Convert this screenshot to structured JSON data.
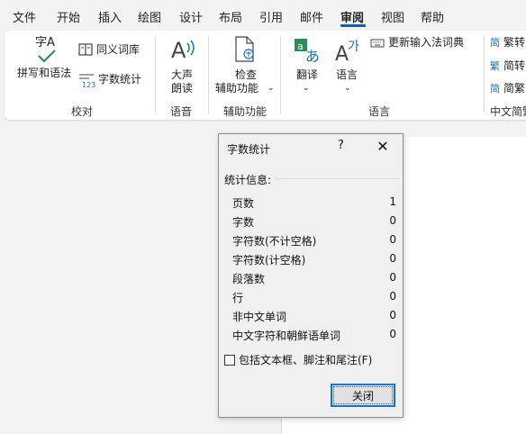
{
  "menu": {
    "items": [
      "文件",
      "开始",
      "插入",
      "绘图",
      "设计",
      "布局",
      "引用",
      "邮件",
      "审阅",
      "视图",
      "帮助"
    ],
    "active": "审阅"
  },
  "ribbon": {
    "proofing": {
      "spelling_label": "拼写和语法",
      "spelling_icon_text": "字A",
      "thesaurus_label": "同义词库",
      "wordcount_label": "字数统计",
      "wordcount_icon_text": "123",
      "group_label": "校对"
    },
    "speech": {
      "read_aloud_line1": "大声",
      "read_aloud_line2": "朗读",
      "group_label": "语音"
    },
    "accessibility": {
      "check_line1": "检查",
      "check_line2": "辅助功能",
      "group_label": "辅助功能"
    },
    "language": {
      "translate_label": "翻译",
      "language_label": "语言",
      "ime_label": "更新输入法词典",
      "group_label": "语言"
    },
    "chinese": {
      "to_trad": "繁转",
      "to_simp": "简转",
      "simp_trad": "简繁",
      "trad_glyph": "简",
      "simp_glyph": "繁",
      "conv_glyph": "简",
      "group_label": "中文简繁"
    }
  },
  "dialog": {
    "title": "字数统计",
    "help": "?",
    "close_glyph": "✕",
    "section_label": "统计信息:",
    "stats": [
      {
        "label": "页数",
        "value": "1"
      },
      {
        "label": "字数",
        "value": "0"
      },
      {
        "label": "字符数(不计空格)",
        "value": "0"
      },
      {
        "label": "字符数(计空格)",
        "value": "0"
      },
      {
        "label": "段落数",
        "value": "0"
      },
      {
        "label": "行",
        "value": "0"
      },
      {
        "label": "非中文单词",
        "value": "0"
      },
      {
        "label": "中文字符和朝鲜语单词",
        "value": "0"
      }
    ],
    "checkbox_label": "包括文本框、脚注和尾注(F)",
    "checkbox_checked": false,
    "close_button": "关闭"
  },
  "colors": {
    "accent": "#0078d4",
    "translate_green": "#2e8b57",
    "translate_blue": "#1a6fb5"
  }
}
